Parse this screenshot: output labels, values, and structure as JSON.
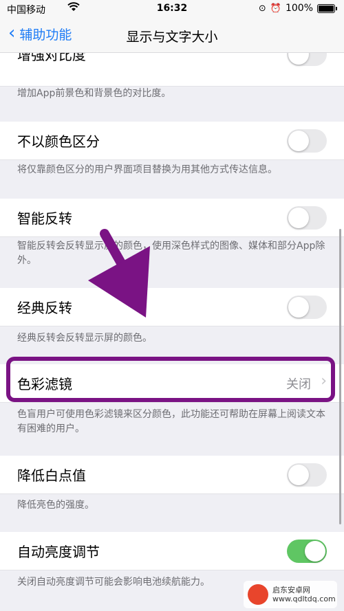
{
  "status_bar": {
    "carrier": "中国移动",
    "time": "16:32",
    "battery": "100%"
  },
  "nav": {
    "back_label": "辅助功能",
    "title": "显示与文字大小"
  },
  "rows": {
    "contrast": {
      "label": "增强对比度",
      "footer": "增加App前景色和背景色的对比度。",
      "on": false
    },
    "differentiate": {
      "label": "不以颜色区分",
      "footer": "将仅靠颜色区分的用户界面项目替换为用其他方式传达信息。",
      "on": false
    },
    "smart_invert": {
      "label": "智能反转",
      "footer": "智能反转会反转显示屏的颜色，使用深色样式的图像、媒体和部分App除外。",
      "on": false
    },
    "classic_invert": {
      "label": "经典反转",
      "footer": "经典反转会反转显示屏的颜色。",
      "on": false
    },
    "color_filters": {
      "label": "色彩滤镜",
      "value": "关闭",
      "footer": "色盲用户可使用色彩滤镜来区分颜色，此功能还可帮助在屏幕上阅读文本有困难的用户。"
    },
    "white_point": {
      "label": "降低白点值",
      "footer": "降低亮色的强度。",
      "on": false
    },
    "auto_brightness": {
      "label": "自动亮度调节",
      "footer": "关闭自动亮度调节可能会影响电池续航能力。",
      "on": true
    }
  },
  "watermark": {
    "line1": "启东安卓网",
    "line2": "www.qdltdq.com"
  },
  "colors": {
    "accent": "#1e7cf6",
    "toggle_on": "#5fc663",
    "highlight": "#7a1384"
  }
}
